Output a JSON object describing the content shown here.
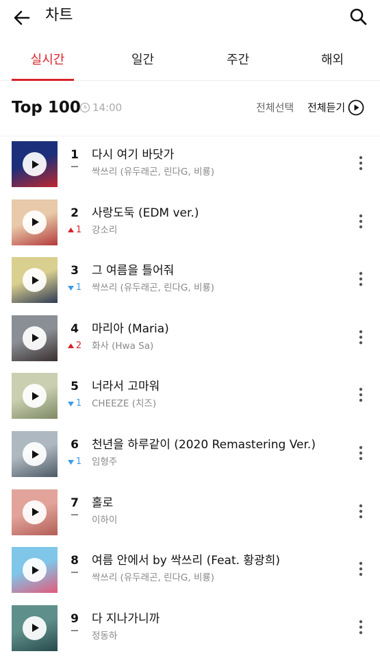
{
  "header": {
    "title": "차트"
  },
  "tabs": [
    {
      "label": "실시간"
    },
    {
      "label": "일간"
    },
    {
      "label": "주간"
    },
    {
      "label": "해외"
    }
  ],
  "section": {
    "title": "Top 100",
    "time": "14:00",
    "select_all": "전체선택",
    "play_all": "전체듣기"
  },
  "songs": [
    {
      "rank": "1",
      "title": "다시 여기 바닷가",
      "artist": "싹쓰리 (유두래곤, 린다G, 비룡)",
      "change_dir": "same",
      "change": "",
      "cover_colors": [
        "#1b2f7a",
        "#c0272d"
      ]
    },
    {
      "rank": "2",
      "title": "사랑도둑 (EDM ver.)",
      "artist": "강소리",
      "change_dir": "up",
      "change": "1",
      "cover_colors": [
        "#e8c9a9",
        "#b33a3a"
      ]
    },
    {
      "rank": "3",
      "title": "그 여름을 틀어줘",
      "artist": "싹쓰리 (유두래곤, 린다G, 비룡)",
      "change_dir": "down",
      "change": "1",
      "cover_colors": [
        "#d9cf8f",
        "#2f3a55"
      ]
    },
    {
      "rank": "4",
      "title": "마리아 (Maria)",
      "artist": "화사 (Hwa Sa)",
      "change_dir": "up",
      "change": "2",
      "cover_colors": [
        "#8a8f95",
        "#3a2f2f"
      ]
    },
    {
      "rank": "5",
      "title": "너라서 고마워",
      "artist": "CHEEZE (치즈)",
      "change_dir": "down",
      "change": "1",
      "cover_colors": [
        "#c9cfb0",
        "#7f8a66"
      ]
    },
    {
      "rank": "6",
      "title": "천년을 하루같이 (2020 Remastering Ver.)",
      "artist": "임형주",
      "change_dir": "down",
      "change": "1",
      "cover_colors": [
        "#aeb8c0",
        "#4d5a66"
      ]
    },
    {
      "rank": "7",
      "title": "홀로",
      "artist": "이하이",
      "change_dir": "same",
      "change": "",
      "cover_colors": [
        "#e2a49a",
        "#b25e56"
      ]
    },
    {
      "rank": "8",
      "title": "여름 안에서 by 싹쓰리 (Feat. 황광희)",
      "artist": "싹쓰리 (유두래곤, 린다G, 비룡)",
      "change_dir": "same",
      "change": "",
      "cover_colors": [
        "#7fc6e8",
        "#e35a7b"
      ]
    },
    {
      "rank": "9",
      "title": "다 지나가니까",
      "artist": "정동하",
      "change_dir": "same",
      "change": "",
      "cover_colors": [
        "#5f8f8a",
        "#274a4c"
      ]
    }
  ],
  "colors": {
    "accent": "#d8232a",
    "up": "#d8232a",
    "down": "#3d9be9"
  }
}
